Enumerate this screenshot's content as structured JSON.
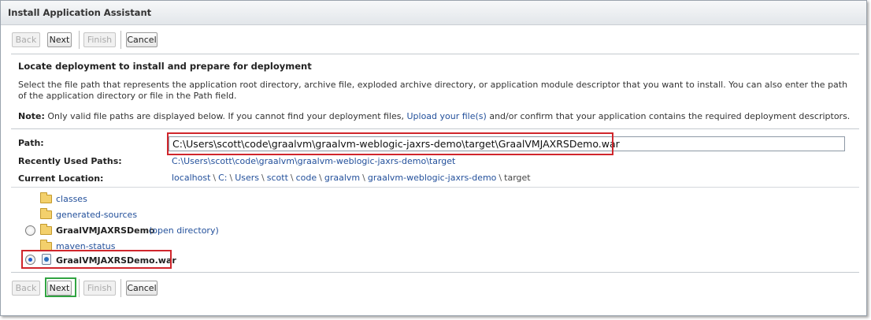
{
  "window": {
    "title": "Install Application Assistant"
  },
  "toolbar": {
    "back": "Back",
    "next": "Next",
    "finish": "Finish",
    "cancel": "Cancel"
  },
  "main": {
    "heading": "Locate deployment to install and prepare for deployment",
    "description": "Select the file path that represents the application root directory, archive file, exploded archive directory, or application module descriptor that you want to install. You can also enter the path of the application directory or file in the Path field.",
    "note_label": "Note:",
    "note_text_before": " Only valid file paths are displayed below. If you cannot find your deployment files, ",
    "note_link": "Upload your file(s)",
    "note_text_after": " and/or confirm that your application contains the required deployment descriptors."
  },
  "path": {
    "label": "Path:",
    "value": "C:\\Users\\scott\\code\\graalvm\\graalvm-weblogic-jaxrs-demo\\target\\GraalVMJAXRSDemo.war"
  },
  "recent": {
    "label": "Recently Used Paths:",
    "value": "C:\\Users\\scott\\code\\graalvm\\graalvm-weblogic-jaxrs-demo\\target"
  },
  "location": {
    "label": "Current Location:",
    "crumbs": [
      "localhost",
      "C:",
      "Users",
      "scott",
      "code",
      "graalvm",
      "graalvm-weblogic-jaxrs-demo"
    ],
    "current": "target",
    "separator": "\\"
  },
  "tree": {
    "classes": "classes",
    "generated_sources": "generated-sources",
    "exploded_name": "GraalVMJAXRSDemo",
    "open_directory": "(open directory)",
    "maven_status": "maven-status",
    "war_name": "GraalVMJAXRSDemo.war",
    "selected": "GraalVMJAXRSDemo.war"
  },
  "colors": {
    "link": "#23509b",
    "highlight_red": "#d0262c",
    "highlight_green": "#31a442"
  }
}
